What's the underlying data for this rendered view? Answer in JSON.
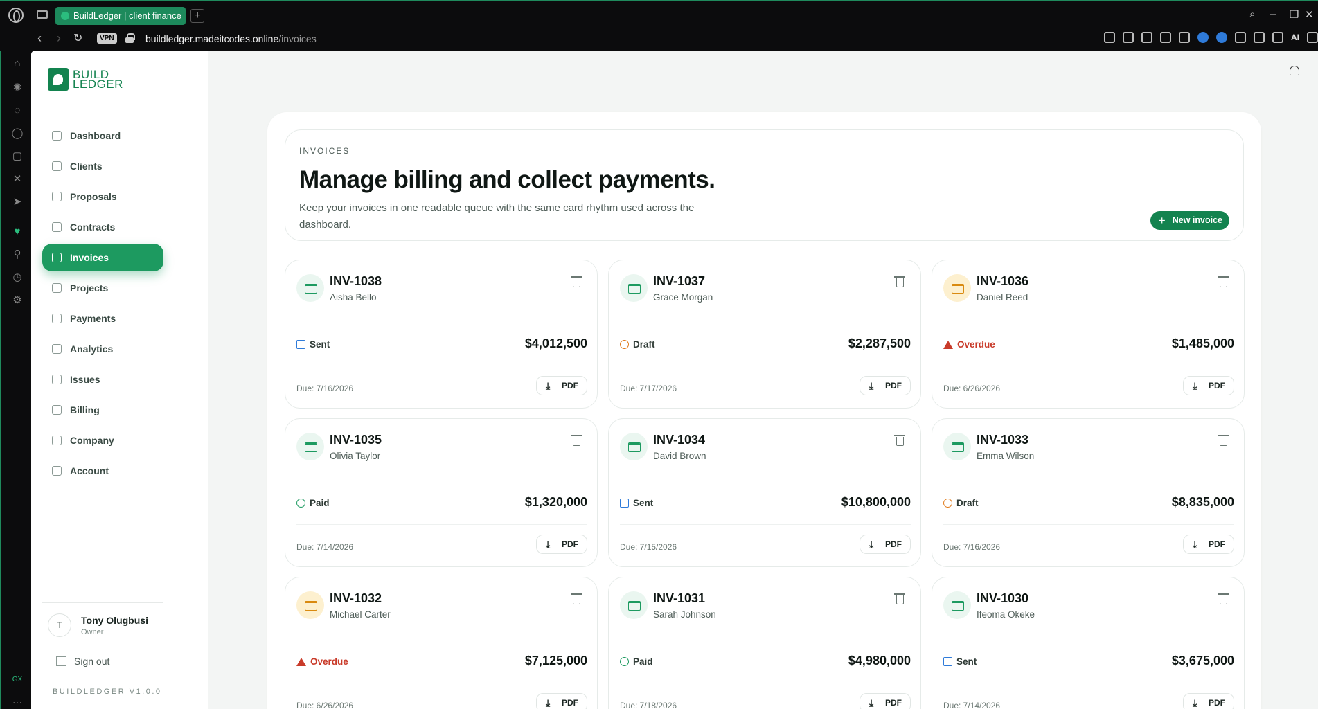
{
  "browser": {
    "tab_title": "BuildLedger | client finance",
    "new_tab": "+",
    "vpn": "VPN",
    "url_domain": "buildledger.madeitcodes.online",
    "url_path": "/invoices",
    "ai_label": "AI"
  },
  "sidebar": {
    "logo_line1": "BUILD",
    "logo_line2": "LEDGER",
    "items": [
      {
        "label": "Dashboard",
        "icon": "home-icon"
      },
      {
        "label": "Clients",
        "icon": "users-icon"
      },
      {
        "label": "Proposals",
        "icon": "file-icon"
      },
      {
        "label": "Contracts",
        "icon": "briefcase-icon"
      },
      {
        "label": "Invoices",
        "icon": "credit-card-icon",
        "active": true
      },
      {
        "label": "Projects",
        "icon": "folder-icon"
      },
      {
        "label": "Payments",
        "icon": "wallet-icon"
      },
      {
        "label": "Analytics",
        "icon": "bar-chart-icon"
      },
      {
        "label": "Issues",
        "icon": "bug-icon"
      },
      {
        "label": "Billing",
        "icon": "dollar-icon"
      },
      {
        "label": "Company",
        "icon": "building-icon"
      },
      {
        "label": "Account",
        "icon": "user-circle-icon"
      }
    ],
    "user": {
      "initial": "T",
      "name": "Tony Olugbusi",
      "role": "Owner"
    },
    "sign_out": "Sign out",
    "version": "BUILDLEDGER V1.0.0"
  },
  "hero": {
    "eyebrow": "INVOICES",
    "title": "Manage billing and collect payments.",
    "subtitle": "Keep your invoices in one readable queue with the same card rhythm used across the dashboard.",
    "new_button": "New invoice"
  },
  "invoices": [
    {
      "id": "INV-1038",
      "client": "Aisha Bello",
      "status": "Sent",
      "amount": "$4,012,500",
      "due": "Due: 7/16/2026",
      "pdf": "PDF"
    },
    {
      "id": "INV-1037",
      "client": "Grace Morgan",
      "status": "Draft",
      "amount": "$2,287,500",
      "due": "Due: 7/17/2026",
      "pdf": "PDF"
    },
    {
      "id": "INV-1036",
      "client": "Daniel Reed",
      "status": "Overdue",
      "amount": "$1,485,000",
      "due": "Due: 6/26/2026",
      "pdf": "PDF"
    },
    {
      "id": "INV-1035",
      "client": "Olivia Taylor",
      "status": "Paid",
      "amount": "$1,320,000",
      "due": "Due: 7/14/2026",
      "pdf": "PDF"
    },
    {
      "id": "INV-1034",
      "client": "David Brown",
      "status": "Sent",
      "amount": "$10,800,000",
      "due": "Due: 7/15/2026",
      "pdf": "PDF"
    },
    {
      "id": "INV-1033",
      "client": "Emma Wilson",
      "status": "Draft",
      "amount": "$8,835,000",
      "due": "Due: 7/16/2026",
      "pdf": "PDF"
    },
    {
      "id": "INV-1032",
      "client": "Michael Carter",
      "status": "Overdue",
      "amount": "$7,125,000",
      "due": "Due: 6/26/2026",
      "pdf": "PDF"
    },
    {
      "id": "INV-1031",
      "client": "Sarah Johnson",
      "status": "Paid",
      "amount": "$4,980,000",
      "due": "Due: 7/18/2026",
      "pdf": "PDF"
    },
    {
      "id": "INV-1030",
      "client": "Ifeoma Okeke",
      "status": "Sent",
      "amount": "$3,675,000",
      "due": "Due: 7/14/2026",
      "pdf": "PDF"
    }
  ],
  "colors": {
    "brand": "#13834f",
    "accent": "#1d9a60",
    "overdue": "#c93b2a",
    "draft": "#e07a1a",
    "sent": "#2f7bd9"
  }
}
